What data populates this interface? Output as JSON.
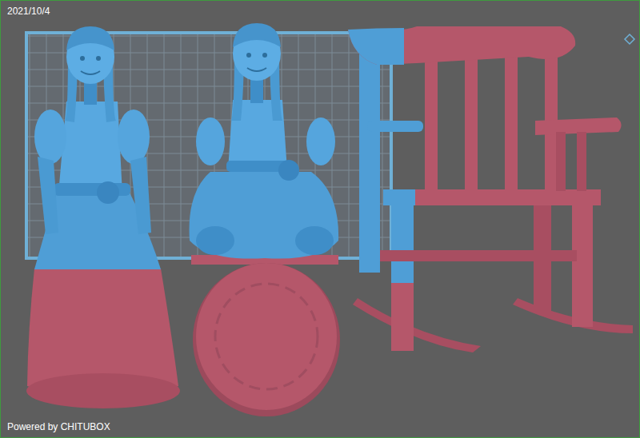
{
  "viewport": {
    "date": "2021/10/4",
    "footer": "Powered by CHITUBOX"
  }
}
